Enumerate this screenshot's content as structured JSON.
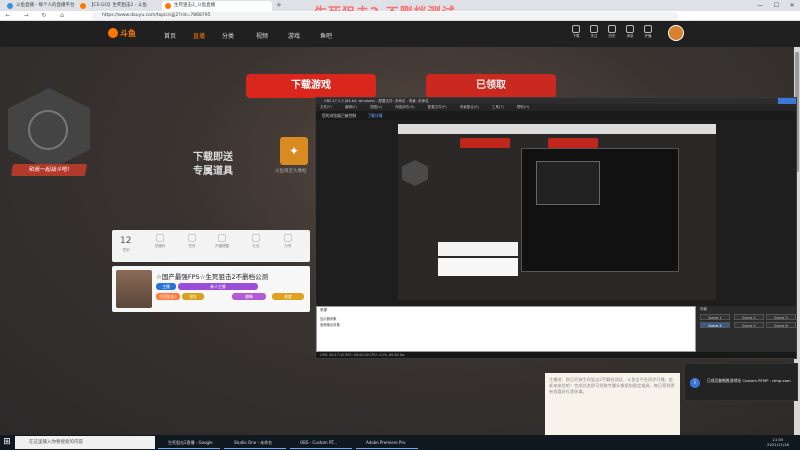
{
  "browser": {
    "tabs": [
      {
        "label": "斗鱼直播 - 每个人的直播平台",
        "icon_color": "#3b8fd6"
      },
      {
        "label": "【CS:GO】生死狙击2 - 斗鱼",
        "icon_color": "#ff7700"
      },
      {
        "label": "生死狙击2_斗鱼直播",
        "icon_color": "#ff7700"
      }
    ],
    "new_tab": "+",
    "url": "https://www.douyu.com/topic/sjjj2?rid=7868795",
    "back": "←",
    "forward": "→",
    "reload": "↻",
    "home": "⌂",
    "window_controls": [
      "—",
      "☐",
      "✕"
    ]
  },
  "overlay_subtitle": "生死狙击2 不删档测试",
  "site": {
    "logo": "斗鱼",
    "nav": [
      "首页",
      "直播",
      "分类",
      "视频",
      "游戏",
      "鱼吧"
    ],
    "nav_active_index": 1,
    "icons": [
      "下载",
      "关注",
      "历史",
      "消息",
      "开播",
      "开通"
    ]
  },
  "hero": {
    "download_button": "下载游戏",
    "claimed_button": "已领取",
    "promo_line1": "下载即送",
    "promo_line2": "专属道具",
    "slogan": "和我一起战斗吧!",
    "gift_caption": "斗鱼限定头像框"
  },
  "tools": {
    "day_count": "12",
    "items": [
      "签到",
      "领福利",
      "任务",
      "开播提醒",
      "礼包",
      "分享"
    ]
  },
  "streamer": {
    "title": "☆国产最强FPS☆生死狙击2不删档公测",
    "badges": [
      "主播",
      "新人主播",
      "生死狙击2",
      "排名",
      "巅峰",
      "热度"
    ]
  },
  "chat": {
    "text": "主播说：即日开放生死狙击2不删档测试，斗鱼全平台同步开播，赶紧来体验吧！完成任务即可领取专属头像框和限定道具，每日签到更有惊喜好礼等你拿。"
  },
  "obs": {
    "title": "OBS 27.1.3 (64-bit, windows) - 配置文件: 未命名 - 场景: 未命名",
    "menu": [
      "文件(F)",
      "编辑(E)",
      "视图(V)",
      "停靠部件(D)",
      "配置文件(P)",
      "场景集合(S)",
      "工具(T)",
      "帮助(H)"
    ],
    "notice": "您的浏览器已被控制",
    "notice_link": "了解详情",
    "sources_label": "来源",
    "scenes_label": "场景",
    "scenes": [
      "Scene 1",
      "Scene 2",
      "Scene 3",
      "Scene 4",
      "Scene 5",
      "Scene 6"
    ],
    "selected_scene_index": 3,
    "status": "LIVE: 00:17:42   REC: 00:00:00   CPU: 4.2%, 60.00 fps",
    "source_items": [
      "显示器采集",
      "音频输出采集"
    ]
  },
  "toast": {
    "icon": "i",
    "text": "已成功复制推流地址 Custom RTMP - rtmp.com"
  },
  "taskbar": {
    "start": "⊞",
    "search_placeholder": "在这里输入你要搜索的内容",
    "items": [
      "生死狙击2直播 - Google",
      "Studio One - 未命名",
      "OBS - Custom RT...",
      "Adobe Premiere Pro"
    ],
    "time": "21:05",
    "date": "2021/11/16"
  }
}
